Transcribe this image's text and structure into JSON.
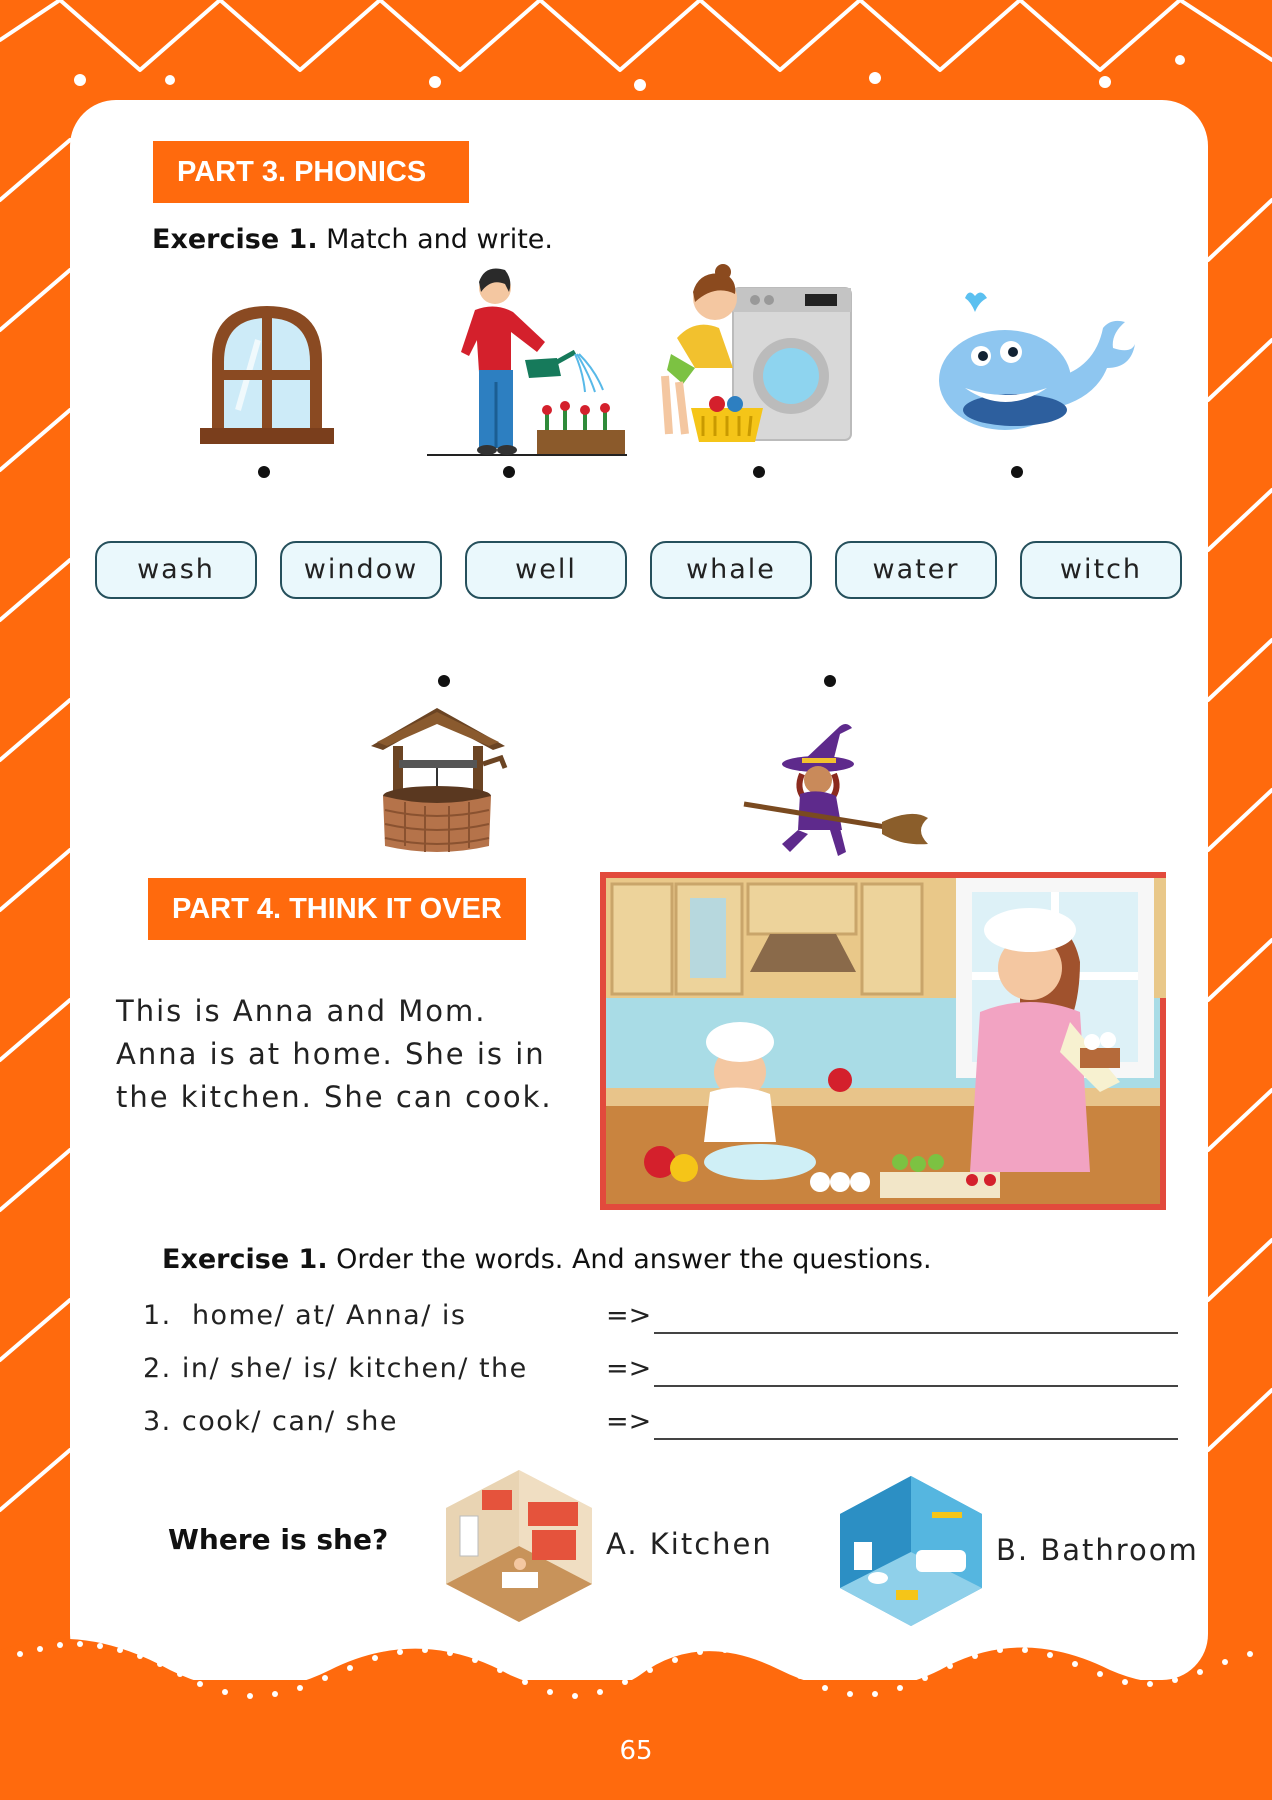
{
  "colors": {
    "brand_orange": "#FF6A0D",
    "word_box_fill": "#EAF8FC",
    "word_box_border": "#25505C"
  },
  "part3": {
    "banner": "PART 3. PHONICS",
    "exercise_label": "Exercise 1.",
    "exercise_text": " Match and write.",
    "pictures": [
      "window-icon",
      "woman-watering-plants-icon",
      "girl-washing-clothes-icon",
      "whale-icon",
      "wishing-well-icon",
      "witch-on-broom-icon"
    ],
    "words": [
      "wash",
      "window",
      "well",
      "whale",
      "water",
      "witch"
    ]
  },
  "part4": {
    "banner": "PART 4. THINK IT OVER",
    "story_line1": "This is Anna and Mom.",
    "story_line2": "Anna is at home. She is in",
    "story_line3": "the kitchen. She can cook.",
    "exercise_label": "Exercise 1.",
    "exercise_text": " Order the words. And answer the questions.",
    "questions": [
      {
        "num": "1.",
        "words": "home/ at/ Anna/ is",
        "arrow": "=>"
      },
      {
        "num": "2.",
        "words": "in/ she/ is/ kitchen/ the",
        "arrow": "=>"
      },
      {
        "num": "3.",
        "words": "cook/ can/ she",
        "arrow": "=>"
      }
    ],
    "where_question": "Where is she?",
    "choice_a": "A. Kitchen",
    "choice_b": "B. Bathroom"
  },
  "page_number": "65"
}
